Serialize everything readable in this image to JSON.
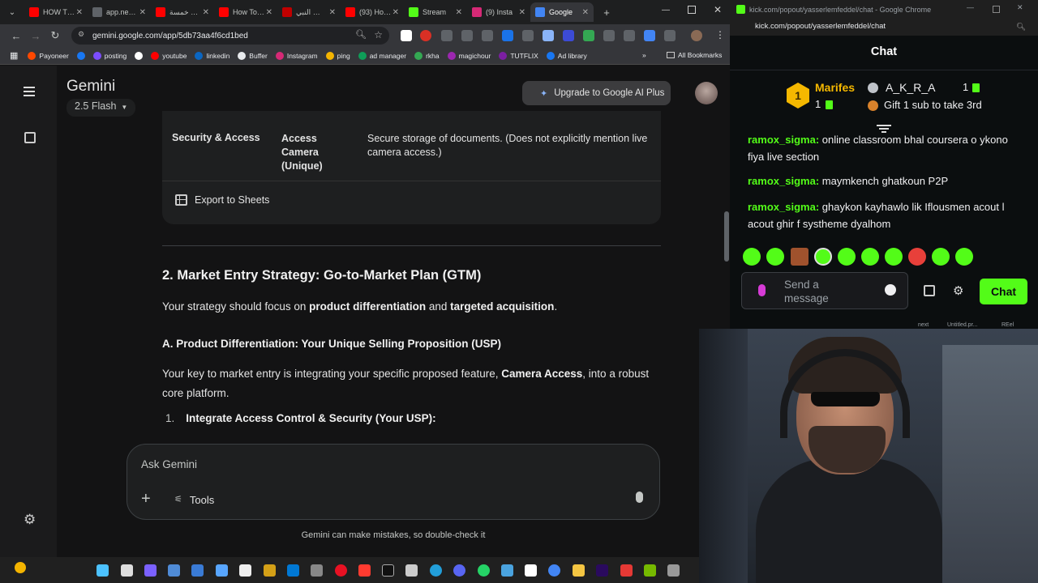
{
  "browser": {
    "tabs": [
      {
        "label": "HOW T…",
        "color": "#ff0000"
      },
      {
        "label": "app.ne…",
        "color": "#5f6368"
      },
      {
        "label": "خمسة …",
        "color": "#ff0000"
      },
      {
        "label": "How To…",
        "color": "#ff0000"
      },
      {
        "label": "النبي …",
        "color": "#c00000"
      },
      {
        "label": "(93) Ho…",
        "color": "#ff0000"
      },
      {
        "label": "Stream",
        "color": "#53fc18"
      },
      {
        "label": "(9) Insta",
        "color": "#d62976"
      },
      {
        "label": "Google",
        "color": "#4285f4"
      }
    ],
    "new_tab": "+",
    "url": "gemini.google.com/app/5db73aa4f6cd1bed",
    "bookmarks": [
      {
        "label": "Payoneer",
        "color": "#ff4800"
      },
      {
        "label": "",
        "color": "#1877f2"
      },
      {
        "label": "posting",
        "color": "#7c4dff"
      },
      {
        "label": "",
        "color": "#ffffff"
      },
      {
        "label": "youtube",
        "color": "#ff0000"
      },
      {
        "label": "linkedin",
        "color": "#0a66c2"
      },
      {
        "label": "Buffer",
        "color": "#e8eaed"
      },
      {
        "label": "Instagram",
        "color": "#d62976"
      },
      {
        "label": "ping",
        "color": "#f4b400"
      },
      {
        "label": "ad manager",
        "color": "#0f9d58"
      },
      {
        "label": "rkha",
        "color": "#34a853"
      },
      {
        "label": "magichour",
        "color": "#9c27b0"
      },
      {
        "label": "TUTFLIX",
        "color": "#7b1fa2"
      },
      {
        "label": "Ad library",
        "color": "#1877f2"
      }
    ],
    "all_bookmarks": "All Bookmarks"
  },
  "gemini": {
    "brand": "Gemini",
    "model": "2.5 Flash",
    "upgrade": "Upgrade to Google AI Plus",
    "table_row": {
      "col1": "Security & Access",
      "col2": "Access Camera (Unique)",
      "col3": "Secure storage of documents. (Does not explicitly mention live camera access.)"
    },
    "export": "Export to Sheets",
    "heading": "2. Market Entry Strategy: Go-to-Market Plan (GTM)",
    "p1_pre": "Your strategy should focus on ",
    "p1_b1": "product differentiation",
    "p1_mid": " and ",
    "p1_b2": "targeted acquisition",
    "p1_end": ".",
    "subheading": "A. Product Differentiation: Your Unique Selling Proposition (USP)",
    "p2_pre": "Your key to market entry is integrating your specific proposed feature, ",
    "p2_b": "Camera Access",
    "p2_end": ", into a robust core platform.",
    "list_num": "1.",
    "list_item": "Integrate Access Control & Security (Your USP):",
    "input_placeholder": "Ask Gemini",
    "tools": "Tools",
    "disclaimer": "Gemini can make mistakes, so double-check it"
  },
  "chat_window": {
    "title": "kick.com/popout/yasserlemfeddel/chat - Google Chrome",
    "url": "kick.com/popout/yasserlemfeddel/chat",
    "header": "Chat",
    "leader_rank": "1",
    "leader1": "Marifes",
    "leader2": "A_K_R_A",
    "leader_count1": "1",
    "leader_count2": "1",
    "gift_prompt": "Gift 1 sub to take 3rd",
    "messages": [
      {
        "user": "ramox_sigma:",
        "text": " online classroom bhal coursera o ykono fiya live section"
      },
      {
        "user": "ramox_sigma:",
        "text": " maymkench ghatkoun P2P"
      },
      {
        "user": "ramox_sigma:",
        "text": " ghaykon kayhawlo lik Iflousmen acout l acout ghir f systheme dyalhom"
      }
    ],
    "send_placeholder": "Send a message",
    "chat_button": "Chat",
    "bottom_labels": [
      "next",
      "Untitled.pr...",
      "REel"
    ]
  },
  "colors": {
    "kick_green": "#53fc18",
    "gemini_bg": "#131314",
    "upgrade_bg": "#3c3c3e"
  }
}
